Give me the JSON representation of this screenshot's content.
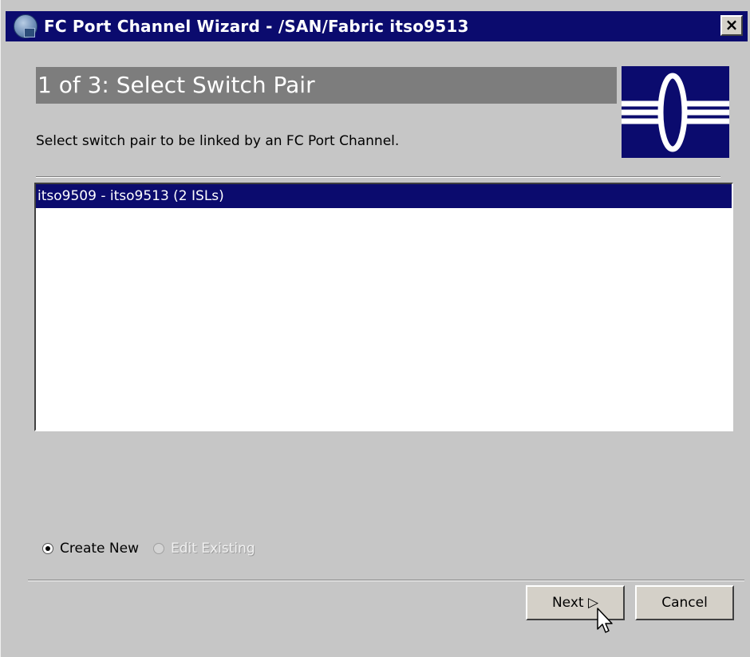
{
  "window": {
    "title": "FC Port Channel Wizard - /SAN/Fabric itso9513",
    "close_label": "×"
  },
  "step": {
    "title": "1 of 3: Select Switch Pair",
    "instruction": "Select switch pair to be linked by an FC Port Channel."
  },
  "switch_pairs": [
    {
      "label": "itso9509 - itso9513 (2 ISLs)",
      "selected": true
    }
  ],
  "mode": {
    "options": [
      {
        "label": "Create New",
        "checked": true,
        "enabled": true
      },
      {
        "label": "Edit Existing",
        "checked": false,
        "enabled": false
      }
    ]
  },
  "buttons": {
    "next": "Next ▷",
    "cancel": "Cancel"
  },
  "colors": {
    "title_bar": "#0b0b6e",
    "window_bg": "#c6c6c6",
    "step_header": "#7d7d7d",
    "selection": "#0b0b6e"
  }
}
